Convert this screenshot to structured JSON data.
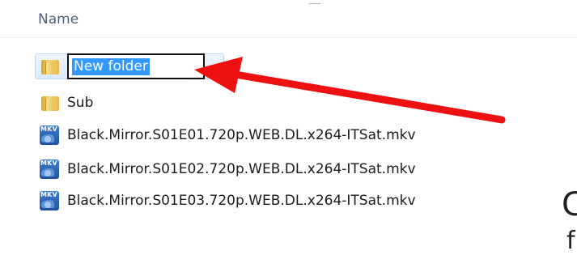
{
  "header": {
    "name_label": "Name"
  },
  "rename": {
    "value": "New folder"
  },
  "items": [
    {
      "label": "Sub",
      "icon": "folder-icon"
    },
    {
      "label": "Black.Mirror.S01E01.720p.WEB.DL.x264-ITSat.mkv",
      "icon": "mkv-file-icon",
      "badge": "MKV"
    },
    {
      "label": "Black.Mirror.S01E02.720p.WEB.DL.x264-ITSat.mkv",
      "icon": "mkv-file-icon",
      "badge": "MKV"
    },
    {
      "label": "Black.Mirror.S01E03.720p.WEB.DL.x264-ITSat.mkv",
      "icon": "mkv-file-icon",
      "badge": "MKV"
    }
  ],
  "overflow_text": {
    "glyph1": "C",
    "glyph2": "f"
  },
  "colors": {
    "selection": "#3399ff",
    "row_highlight": "#dbeafb",
    "arrow": "#ee1111",
    "header_text": "#4c607a"
  }
}
